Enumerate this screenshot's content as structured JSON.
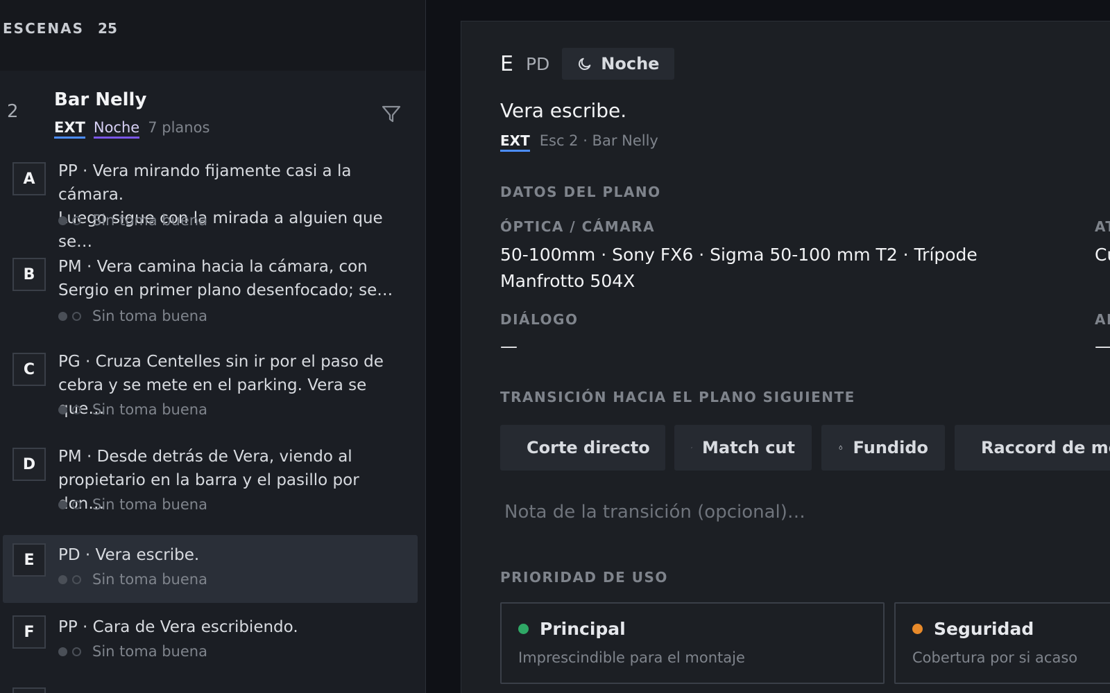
{
  "sidebar": {
    "title": "ESCENAS",
    "count": "25",
    "scene": {
      "number": "2",
      "name": "Bar Nelly",
      "tag_ext": "EXT",
      "tag_time": "Noche",
      "shots_count": "7 planos"
    },
    "shots": [
      {
        "letter": "A",
        "line1": "PP · Vera mirando fijamente casi a la cámara.",
        "line2": "Luego sigue con la mirada a alguien que se…",
        "status": "Sin toma buena"
      },
      {
        "letter": "B",
        "line1": "PM · Vera camina hacia la cámara, con",
        "line2": "Sergio en primer plano desenfocado; se…",
        "status": "Sin toma buena"
      },
      {
        "letter": "C",
        "line1": "PG · Cruza Centelles sin ir por el paso de",
        "line2": "cebra y se mete en el parking. Vera se que…",
        "status": "Sin toma buena"
      },
      {
        "letter": "D",
        "line1": "PM · Desde detrás de Vera, viendo al",
        "line2": "propietario en la barra y el pasillo por don…",
        "status": "Sin toma buena"
      },
      {
        "letter": "E",
        "line1": "PD · Vera escribe.",
        "line2": "",
        "status": "Sin toma buena"
      },
      {
        "letter": "F",
        "line1": "PP · Cara de Vera escribiendo.",
        "line2": "",
        "status": "Sin toma buena"
      }
    ]
  },
  "main": {
    "letter": "E",
    "shot_type": "PD",
    "time_badge": "Noche",
    "description": "Vera escribe.",
    "tag_ext": "EXT",
    "scene_ref": "Esc 2 · Bar Nelly",
    "section_data": "DATOS DEL PLANO",
    "optics_label": "ÓPTICA / CÁMARA",
    "optics_line1": "50-100mm · Sony FX6 · Sigma 50-100 mm T2 · Trípode",
    "optics_line2": "Manfrotto 504X",
    "right_label_1": "AT",
    "right_value_1": "Cu",
    "dialog_label": "DIÁLOGO",
    "dialog_value": "—",
    "right_label_2": "AN",
    "right_value_2": "—",
    "transition_label": "TRANSICIÓN HACIA EL PLANO SIGUIENTE",
    "transitions": [
      {
        "label": "Corte directo",
        "icon": "scissors-icon"
      },
      {
        "label": "Match cut",
        "icon": "link-icon"
      },
      {
        "label": "Fundido",
        "icon": "drop-icon"
      },
      {
        "label": "Raccord de mo",
        "icon": "refresh-icon"
      }
    ],
    "note_placeholder": "Nota de la transición (opcional)…",
    "priority_label": "PRIORIDAD DE USO",
    "priorities": [
      {
        "title": "Principal",
        "subtitle": "Imprescindible para el montaje",
        "color": "#2fa866"
      },
      {
        "title": "Seguridad",
        "subtitle": "Cobertura por si acaso",
        "color": "#e88a2a"
      }
    ]
  }
}
